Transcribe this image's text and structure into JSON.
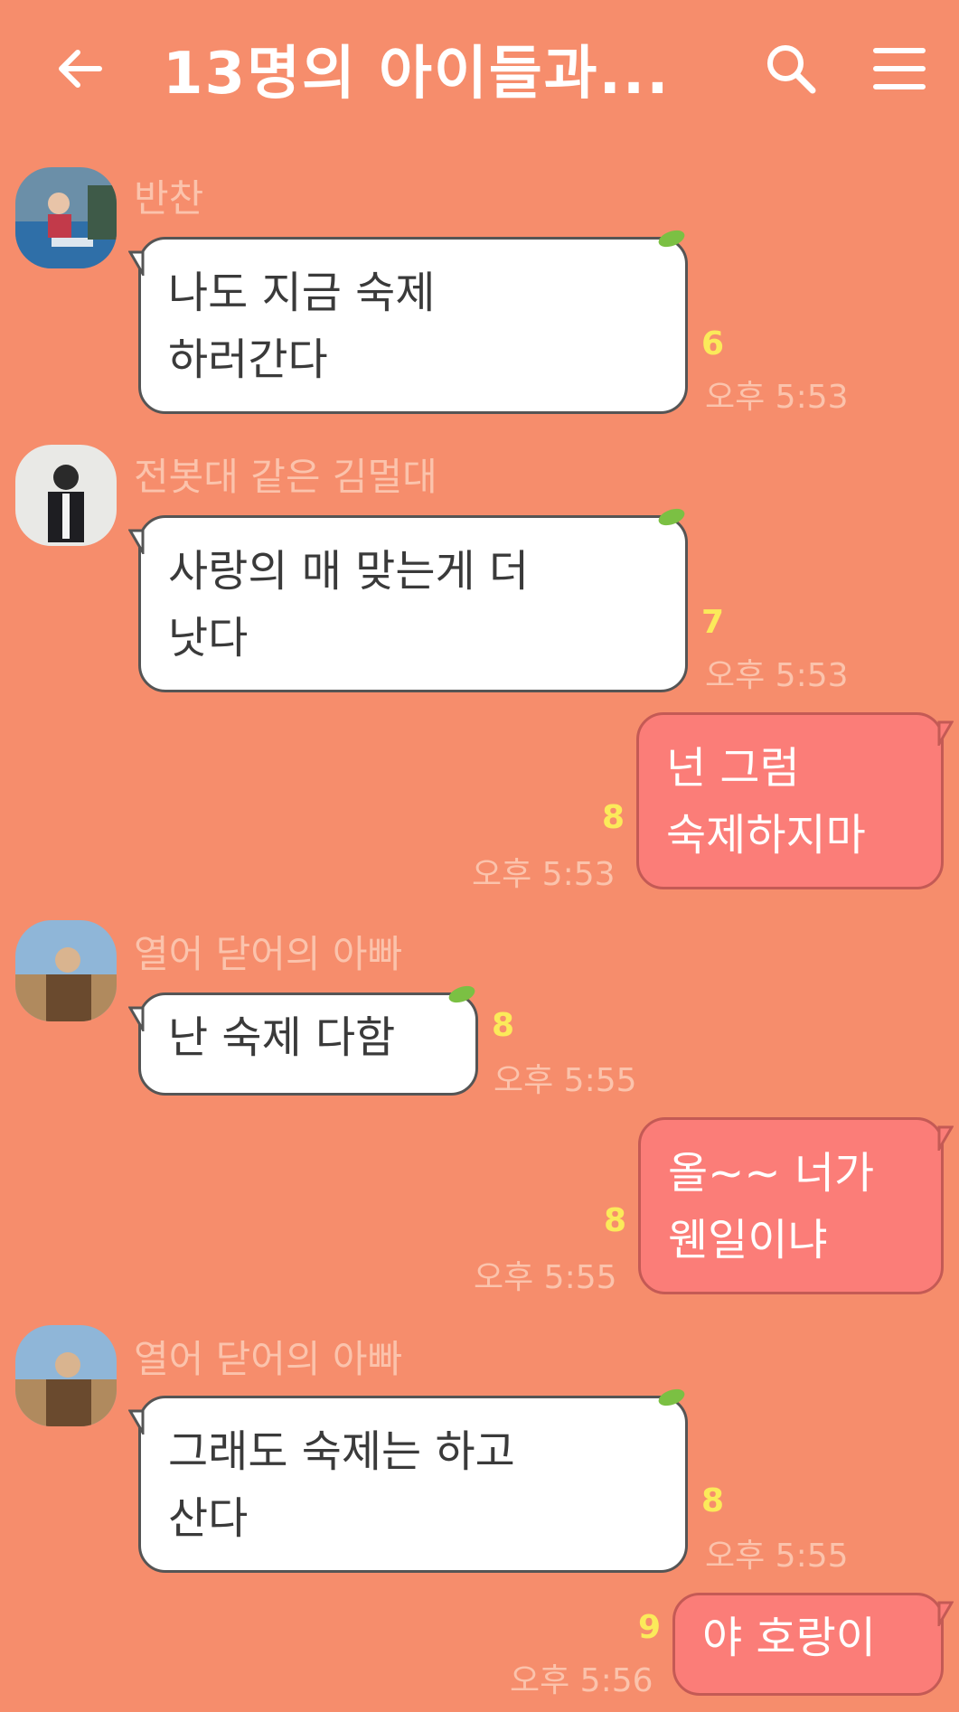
{
  "header": {
    "title": "13명의 아이들과...",
    "back_icon": "arrow-left-icon",
    "search_icon": "search-icon",
    "menu_icon": "hamburger-menu-icon"
  },
  "messages": [
    {
      "direction": "incoming",
      "sender": "반찬",
      "lines": [
        "나도 지금 숙제",
        "하러간다"
      ],
      "unread": "6",
      "time": "오후 5:53"
    },
    {
      "direction": "incoming",
      "sender": "전봇대 같은 김멀대",
      "lines": [
        "사랑의 매 맞는게 더",
        "낫다"
      ],
      "unread": "7",
      "time": "오후 5:53"
    },
    {
      "direction": "outgoing",
      "lines": [
        "넌 그럼",
        "숙제하지마"
      ],
      "unread": "8",
      "time": "오후 5:53"
    },
    {
      "direction": "incoming",
      "sender": "열어 닫어의 아빠",
      "lines": [
        "난 숙제 다함"
      ],
      "unread": "8",
      "time": "오후 5:55"
    },
    {
      "direction": "outgoing",
      "lines": [
        "올~~ 너가",
        "웬일이냐"
      ],
      "unread": "8",
      "time": "오후 5:55"
    },
    {
      "direction": "incoming",
      "sender": "열어 닫어의 아빠",
      "lines": [
        "그래도 숙제는 하고",
        "산다"
      ],
      "unread": "8",
      "time": "오후 5:55"
    },
    {
      "direction": "outgoing",
      "lines": [
        "야 호랑이"
      ],
      "unread": "9",
      "time": "오후 5:56"
    }
  ],
  "colors": {
    "background": "#F68D6C",
    "incoming_bubble": "#FFFFFF",
    "outgoing_bubble": "#FB7D78",
    "unread_count": "#FBEA5A",
    "meta_text": "#FBC3AC"
  }
}
